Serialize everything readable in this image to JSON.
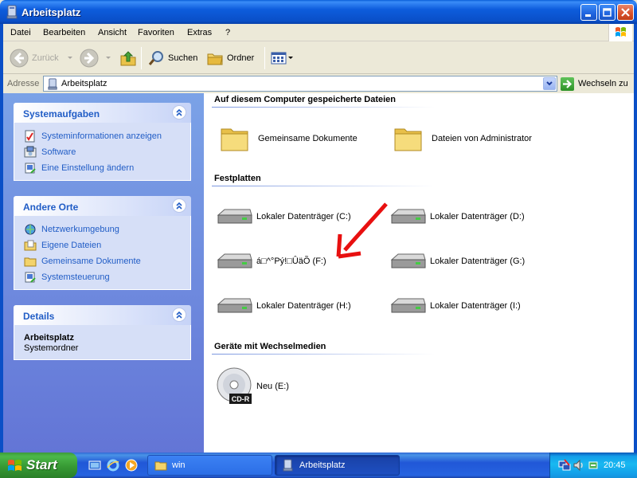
{
  "window": {
    "title": "Arbeitsplatz"
  },
  "menu": {
    "items": [
      "Datei",
      "Bearbeiten",
      "Ansicht",
      "Favoriten",
      "Extras",
      "?"
    ]
  },
  "toolbar": {
    "back_label": "Zurück",
    "search_label": "Suchen",
    "folders_label": "Ordner"
  },
  "address": {
    "label": "Adresse",
    "value": "Arbeitsplatz",
    "go_label": "Wechseln zu"
  },
  "sidebar": {
    "system_tasks": {
      "title": "Systemaufgaben",
      "items": [
        {
          "label": "Systeminformationen anzeigen",
          "icon": "system-info-icon"
        },
        {
          "label": "Software",
          "icon": "software-icon"
        },
        {
          "label": "Eine Einstellung ändern",
          "icon": "change-setting-icon"
        }
      ]
    },
    "other_places": {
      "title": "Andere Orte",
      "items": [
        {
          "label": "Netzwerkumgebung",
          "icon": "network-icon"
        },
        {
          "label": "Eigene Dateien",
          "icon": "my-documents-icon"
        },
        {
          "label": "Gemeinsame Dokumente",
          "icon": "folder-icon"
        },
        {
          "label": "Systemsteuerung",
          "icon": "control-panel-icon"
        }
      ]
    },
    "details": {
      "title": "Details",
      "name": "Arbeitsplatz",
      "type": "Systemordner"
    }
  },
  "content": {
    "groups": [
      {
        "title": "Auf diesem Computer gespeicherte Dateien",
        "items": [
          {
            "label": "Gemeinsame Dokumente",
            "icon": "folder-icon"
          },
          {
            "label": "Dateien von Administrator",
            "icon": "folder-icon"
          }
        ]
      },
      {
        "title": "Festplatten",
        "items": [
          {
            "label": "Lokaler Datenträger (C:)",
            "icon": "hard-drive-icon"
          },
          {
            "label": "Lokaler Datenträger (D:)",
            "icon": "hard-drive-icon"
          },
          {
            "label": "á□^°Pý!□ÛäÕ (F:)",
            "icon": "hard-drive-icon"
          },
          {
            "label": "Lokaler Datenträger (G:)",
            "icon": "hard-drive-icon"
          },
          {
            "label": "Lokaler Datenträger (H:)",
            "icon": "hard-drive-icon"
          },
          {
            "label": "Lokaler Datenträger (I:)",
            "icon": "hard-drive-icon"
          }
        ]
      },
      {
        "title": "Geräte mit Wechselmedien",
        "items": [
          {
            "label": "Neu (E:)",
            "icon": "cd-r-icon",
            "badge": "CD-R"
          }
        ]
      }
    ]
  },
  "taskbar": {
    "start_label": "Start",
    "tasks": [
      {
        "label": "win",
        "icon": "folder-icon"
      },
      {
        "label": "Arbeitsplatz",
        "icon": "computer-icon"
      }
    ],
    "clock": "20:45"
  },
  "colors": {
    "titlebar": "#0a4fc7",
    "sidebar_link": "#215dc6",
    "start_green": "#3c9a3c",
    "annotation_arrow": "#e81010"
  }
}
